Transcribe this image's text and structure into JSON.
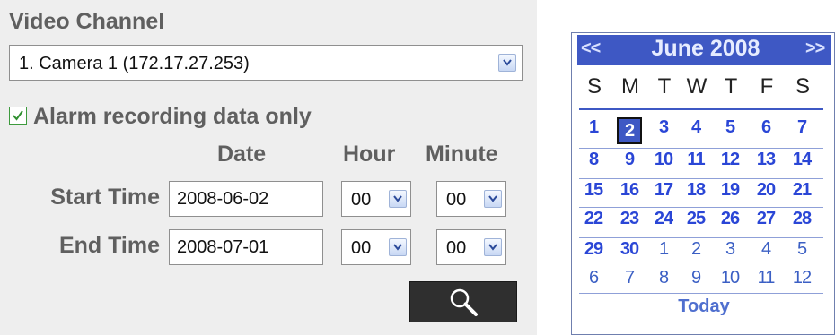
{
  "form": {
    "title": "Video Channel",
    "channel_value": "1. Camera 1 (172.17.27.253)",
    "alarm_checked": true,
    "alarm_label": "Alarm recording data only",
    "headers": {
      "date": "Date",
      "hour": "Hour",
      "minute": "Minute"
    },
    "start": {
      "label": "Start Time",
      "date": "2008-06-02",
      "hour": "00",
      "minute": "00"
    },
    "end": {
      "label": "End Time",
      "date": "2008-07-01",
      "hour": "00",
      "minute": "00"
    },
    "search_icon": "magnifier-icon"
  },
  "calendar": {
    "prev": "<<",
    "next": ">>",
    "title": "June 2008",
    "weekdays": [
      "S",
      "M",
      "T",
      "W",
      "T",
      "F",
      "S"
    ],
    "weeks": [
      [
        {
          "d": "1",
          "m": "cur"
        },
        {
          "d": "2",
          "m": "sel"
        },
        {
          "d": "3",
          "m": "cur"
        },
        {
          "d": "4",
          "m": "cur"
        },
        {
          "d": "5",
          "m": "cur"
        },
        {
          "d": "6",
          "m": "cur"
        },
        {
          "d": "7",
          "m": "cur"
        }
      ],
      [
        {
          "d": "8",
          "m": "cur"
        },
        {
          "d": "9",
          "m": "cur"
        },
        {
          "d": "10",
          "m": "cur"
        },
        {
          "d": "11",
          "m": "cur"
        },
        {
          "d": "12",
          "m": "cur"
        },
        {
          "d": "13",
          "m": "cur"
        },
        {
          "d": "14",
          "m": "cur"
        }
      ],
      [
        {
          "d": "15",
          "m": "cur"
        },
        {
          "d": "16",
          "m": "cur"
        },
        {
          "d": "17",
          "m": "cur"
        },
        {
          "d": "18",
          "m": "cur"
        },
        {
          "d": "19",
          "m": "cur"
        },
        {
          "d": "20",
          "m": "cur"
        },
        {
          "d": "21",
          "m": "cur"
        }
      ],
      [
        {
          "d": "22",
          "m": "cur"
        },
        {
          "d": "23",
          "m": "cur"
        },
        {
          "d": "24",
          "m": "cur"
        },
        {
          "d": "25",
          "m": "cur"
        },
        {
          "d": "26",
          "m": "cur"
        },
        {
          "d": "27",
          "m": "cur"
        },
        {
          "d": "28",
          "m": "cur"
        }
      ],
      [
        {
          "d": "29",
          "m": "cur"
        },
        {
          "d": "30",
          "m": "cur"
        },
        {
          "d": "1",
          "m": "other"
        },
        {
          "d": "2",
          "m": "other"
        },
        {
          "d": "3",
          "m": "other"
        },
        {
          "d": "4",
          "m": "other"
        },
        {
          "d": "5",
          "m": "other"
        }
      ],
      [
        {
          "d": "6",
          "m": "other"
        },
        {
          "d": "7",
          "m": "other"
        },
        {
          "d": "8",
          "m": "other"
        },
        {
          "d": "9",
          "m": "other"
        },
        {
          "d": "10",
          "m": "other"
        },
        {
          "d": "11",
          "m": "other"
        },
        {
          "d": "12",
          "m": "other"
        }
      ]
    ],
    "today_label": "Today"
  },
  "colors": {
    "panel_bg": "#eeeeee",
    "label_text": "#5f5f5f",
    "calendar_accent": "#3e58c4",
    "day_text": "#2a46d6",
    "checkbox_green": "#3d9a3d"
  }
}
